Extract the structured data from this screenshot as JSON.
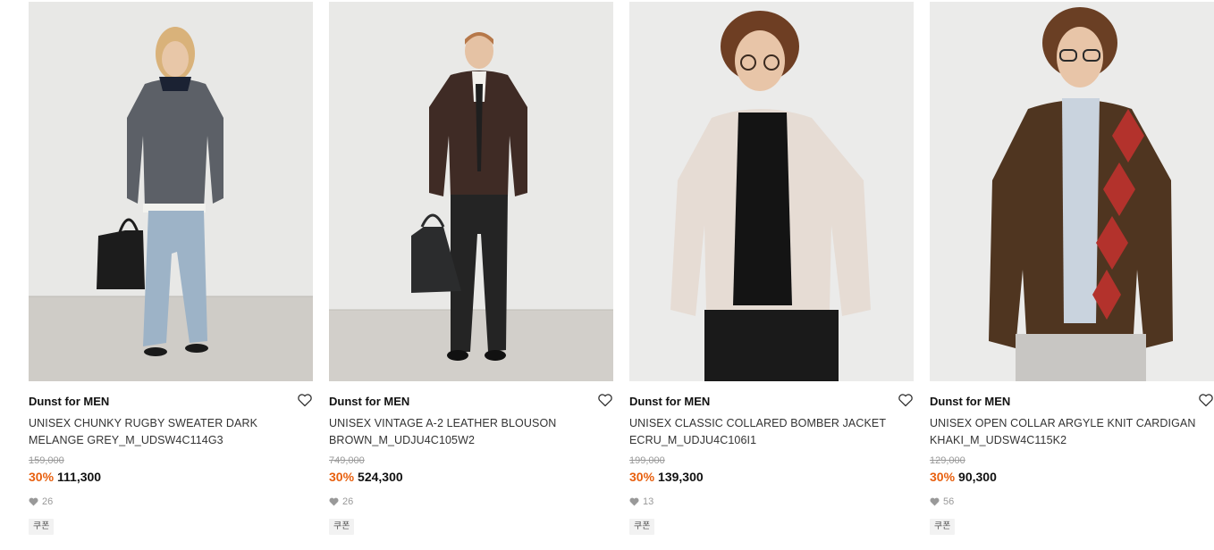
{
  "products": [
    {
      "brand": "Dunst for MEN",
      "name": "UNISEX CHUNKY RUGBY SWEATER DARK MELANGE GREY_M_UDSW4C114G3",
      "original_price": "159,000",
      "discount": "30%",
      "sale_price": "111,300",
      "likes": "26",
      "badge": "쿠폰"
    },
    {
      "brand": "Dunst for MEN",
      "name": "UNISEX VINTAGE A-2 LEATHER BLOUSON BROWN_M_UDJU4C105W2",
      "original_price": "749,000",
      "discount": "30%",
      "sale_price": "524,300",
      "likes": "26",
      "badge": "쿠폰"
    },
    {
      "brand": "Dunst for MEN",
      "name": "UNISEX CLASSIC COLLARED BOMBER JACKET ECRU_M_UDJU4C106I1",
      "original_price": "199,000",
      "discount": "30%",
      "sale_price": "139,300",
      "likes": "13",
      "badge": "쿠폰"
    },
    {
      "brand": "Dunst for MEN",
      "name": "UNISEX OPEN COLLAR ARGYLE KNIT CARDIGAN KHAKI_M_UDSW4C115K2",
      "original_price": "129,000",
      "discount": "30%",
      "sale_price": "90,300",
      "likes": "56",
      "badge": "쿠폰"
    }
  ],
  "colors": {
    "discount": "#e8600f",
    "text": "#111111",
    "muted": "#999999",
    "badge_bg": "#f2f2f2"
  },
  "icons": {
    "wish": "heart-outline-icon",
    "likes": "heart-filled-icon"
  }
}
